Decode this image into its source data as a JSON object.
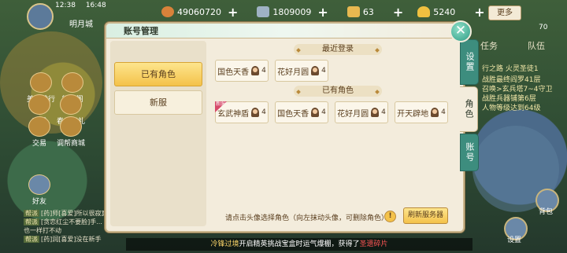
{
  "topbar": {
    "resources": [
      {
        "name": "copper-coin",
        "value": "49060720",
        "color": "#d9823a"
      },
      {
        "name": "silver-ticket",
        "value": "1809009",
        "color": "#9fb2c4"
      },
      {
        "name": "gold-paper",
        "value": "63",
        "color": "#e8b850"
      },
      {
        "name": "gold-ingot",
        "value": "5240",
        "color": "#f0c040"
      }
    ],
    "more_label": "更多"
  },
  "player": {
    "time": "12:38",
    "clock": "16:48",
    "location": "明月城"
  },
  "left_icons": [
    "美食排行",
    "征宝阁",
    "商城",
    "春季好礼",
    "交易",
    "调帮商城",
    "好友"
  ],
  "chat_lines": [
    {
      "tag": "帮派",
      "text": "[药]师[喜爱]所以很寂寞"
    },
    {
      "tag": "帮派",
      "text": "[贪恋红尘不要脸]手..."
    },
    {
      "tag": "",
      "text": "也一样打不动"
    },
    {
      "tag": "帮派",
      "text": "[药]润[喜爱]没在新手"
    }
  ],
  "right_side": {
    "tabs": [
      "任务",
      "队伍"
    ],
    "badge": "70",
    "quests": [
      "行之路 火灵圣徒1",
      "战胜最终阎罗41层",
      "召唤>玄兵塔7~4守卫",
      "战胜兵器铺第6层",
      "人物等级达到64级"
    ],
    "bottom_labels": [
      "背包",
      "设置"
    ]
  },
  "ticker": {
    "prefix": "冷锋过境",
    "mid1": "开启精英挑战宝盒时运气爆棚，获得了",
    "item": "圣遗碎片"
  },
  "dialog": {
    "title": "账号管理",
    "left_tabs": [
      {
        "label": "已有角色"
      },
      {
        "label": "新服"
      }
    ],
    "recent_title": "最近登录",
    "recent_roles": [
      {
        "server": "国色天香",
        "count": "4"
      },
      {
        "server": "花好月圆",
        "count": "4"
      }
    ],
    "owned_title": "已有角色",
    "owned_roles": [
      {
        "server": "玄武神盾",
        "count": "4",
        "badge": "新服"
      },
      {
        "server": "国色天香",
        "count": "4"
      },
      {
        "server": "花好月圆",
        "count": "4"
      },
      {
        "server": "开天辟地",
        "count": "4"
      }
    ],
    "hint": "请点击头像选择角色（向左抹动头像，可删除角色）",
    "refresh_label": "刷新服务器",
    "side_tabs": [
      "设置",
      "角色",
      "账号"
    ]
  }
}
